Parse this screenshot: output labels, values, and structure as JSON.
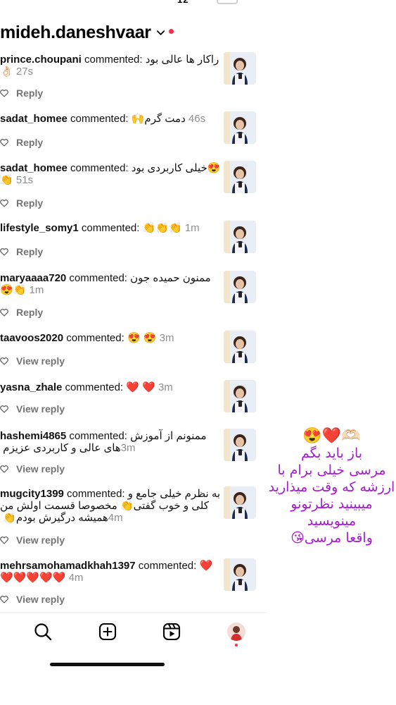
{
  "status_bar": {
    "time_fragment": "12"
  },
  "header": {
    "username": "mideh.daneshvaar"
  },
  "comments": [
    {
      "user": "prince.choupani",
      "verb": " commented: ",
      "text": "راکار ها عالی بود",
      "line2": "👌🏻 ",
      "time": "27s",
      "action": "Reply"
    },
    {
      "user": "sadat_homee",
      "verb": " commented: ",
      "text": "دمت گرم🙌",
      "line2": "",
      "time": "46s",
      "action": "Reply"
    },
    {
      "user": "sadat_homee",
      "verb": " commented: ",
      "text": "😍خیلی کاربردی بود",
      "line2": "👏 ",
      "time": "51s",
      "action": "Reply"
    },
    {
      "user": "lifestyle_somy1",
      "verb": " commented: ",
      "text": "👏👏👏",
      "line2": "",
      "time": "1m",
      "action": "Reply"
    },
    {
      "user": "maryaaaa720",
      "verb": " commented: ",
      "text": "ممنون حمیده جون",
      "line2": "😍👏 ",
      "time": "1m",
      "action": "Reply"
    },
    {
      "user": "taavoos2020",
      "verb": " commented: ",
      "text": "😍 😍",
      "line2": "",
      "time": "3m",
      "action": "View reply"
    },
    {
      "user": "yasna_zhale",
      "verb": " commented: ",
      "text": "❤️ ❤️",
      "line2": "",
      "time": "3m",
      "action": "View reply"
    },
    {
      "user": "hashemi4865",
      "verb": " commented: ",
      "text": "ممنونم از آموزش",
      "line2": "های عالی و کاربردی عزیزم ",
      "time": "3m",
      "action": "View reply"
    },
    {
      "user": "mugcity1399",
      "verb": " commented: ",
      "text": "به نظرم خیلی جامع و",
      "line2": "کلی و خوب گفتی👏 مخصوصا قسمت اولش من",
      "line3": "همیشه درگیرش بودم👏 ",
      "time": "4m",
      "action": "View reply"
    },
    {
      "user": "mehrsamohamadkhah1397",
      "verb": " commented: ",
      "text": "❤️",
      "line2": "❤️❤️❤️❤️❤️ ",
      "time": "4m",
      "action": "View reply"
    }
  ],
  "overlay_note": {
    "emojis": "😍❤️🫶🏻",
    "lines": [
      "باز باید بگم",
      "مرسی خیلی برام با",
      "ارزشه که وقت میذارید",
      "میبینید نظرتونو",
      "مینویسید",
      "واقعا مرسی😘"
    ],
    "color": "#a51bd0"
  },
  "colors": {
    "accent_dot": "#ff2d4b",
    "secondary_text": "#737373"
  }
}
